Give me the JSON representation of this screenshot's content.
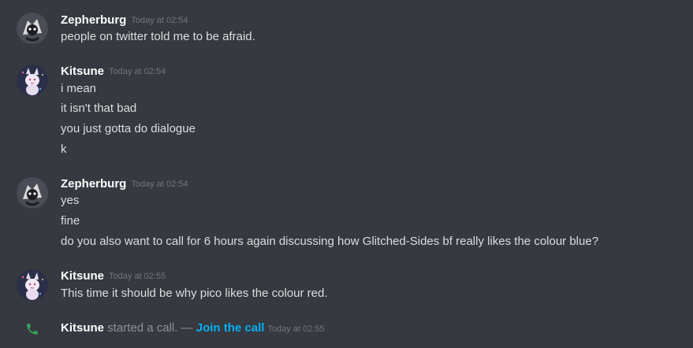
{
  "colors": {
    "background": "#36393f",
    "username": "#ffffff",
    "message_text": "#dcddde",
    "timestamp": "#72767d",
    "link": "#00b0f4",
    "call_icon": "#3ba55c"
  },
  "groups": [
    {
      "author": "Zepherburg",
      "avatar": "zepherburg-avatar",
      "timestamp": "Today at 02:54",
      "messages": [
        "people on twitter told me to be afraid."
      ]
    },
    {
      "author": "Kitsune",
      "avatar": "kitsune-avatar",
      "timestamp": "Today at 02:54",
      "messages": [
        "i mean",
        "it isn't that bad",
        "you just gotta do dialogue",
        "k"
      ]
    },
    {
      "author": "Zepherburg",
      "avatar": "zepherburg-avatar",
      "timestamp": "Today at 02:54",
      "messages": [
        "yes",
        "fine",
        "do you also want to call for 6 hours again discussing how Glitched-Sides bf really likes the colour blue?"
      ]
    },
    {
      "author": "Kitsune",
      "avatar": "kitsune-avatar",
      "timestamp": "Today at 02:55",
      "messages": [
        "This time it should be why pico likes the colour red."
      ]
    }
  ],
  "system": {
    "icon": "phone-icon",
    "user": "Kitsune",
    "action": " started a call. — ",
    "link": "Join the call",
    "timestamp": "Today at 02:55"
  }
}
